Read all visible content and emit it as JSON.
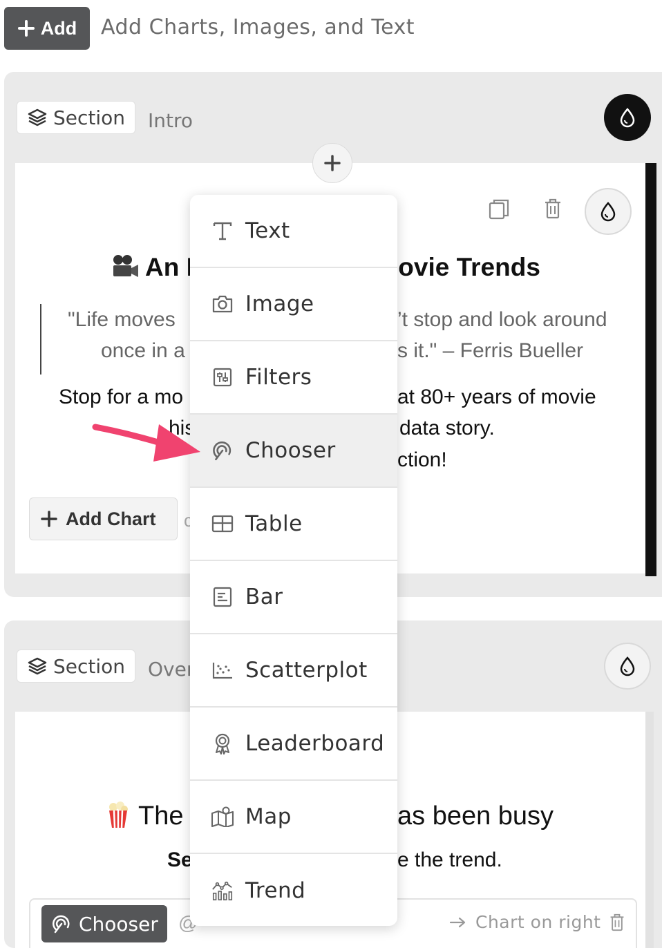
{
  "toolbar": {
    "add_label": "Add",
    "add_hint": "Add Charts, Images, and Text"
  },
  "section1": {
    "pill_label": "Section",
    "name": "Intro",
    "title_left": "An I",
    "title_right": "lovie Trends",
    "quote_line1_left": "\"Life moves",
    "quote_line1_right": "’t stop and look around",
    "quote_line2_left": "once in a",
    "quote_line2_right": "s it.\" – Ferris Bueller",
    "body_line1_left": "Stop for a mo",
    "body_line1_right": "at 80+ years of movie",
    "body_line2_left": "his",
    "body_line2_right": "data story.",
    "body_line3_right": "ction!",
    "add_chart_label": "Add Chart",
    "add_chart_trail": "c"
  },
  "section2": {
    "pill_label": "Section",
    "name": "Over",
    "title_left": "The",
    "title_right": "as been busy",
    "subtitle_left": "Se",
    "subtitle_right": "e the trend.",
    "chooser_label": "Chooser",
    "at_symbol": "@",
    "chart_right_label": "Chart on right"
  },
  "menu": {
    "items": [
      {
        "label": "Text",
        "icon": "text-icon"
      },
      {
        "label": "Image",
        "icon": "camera-icon"
      },
      {
        "label": "Filters",
        "icon": "filters-icon"
      },
      {
        "label": "Chooser",
        "icon": "chooser-icon"
      },
      {
        "label": "Table",
        "icon": "table-icon"
      },
      {
        "label": "Bar",
        "icon": "bar-icon"
      },
      {
        "label": "Scatterplot",
        "icon": "scatterplot-icon"
      },
      {
        "label": "Leaderboard",
        "icon": "leaderboard-icon"
      },
      {
        "label": "Map",
        "icon": "map-icon"
      },
      {
        "label": "Trend",
        "icon": "trend-icon"
      }
    ],
    "active_index": 3
  },
  "colors": {
    "accent_arrow": "#f0436f",
    "dark_button": "#555658",
    "section_bg": "#eaeaea"
  }
}
